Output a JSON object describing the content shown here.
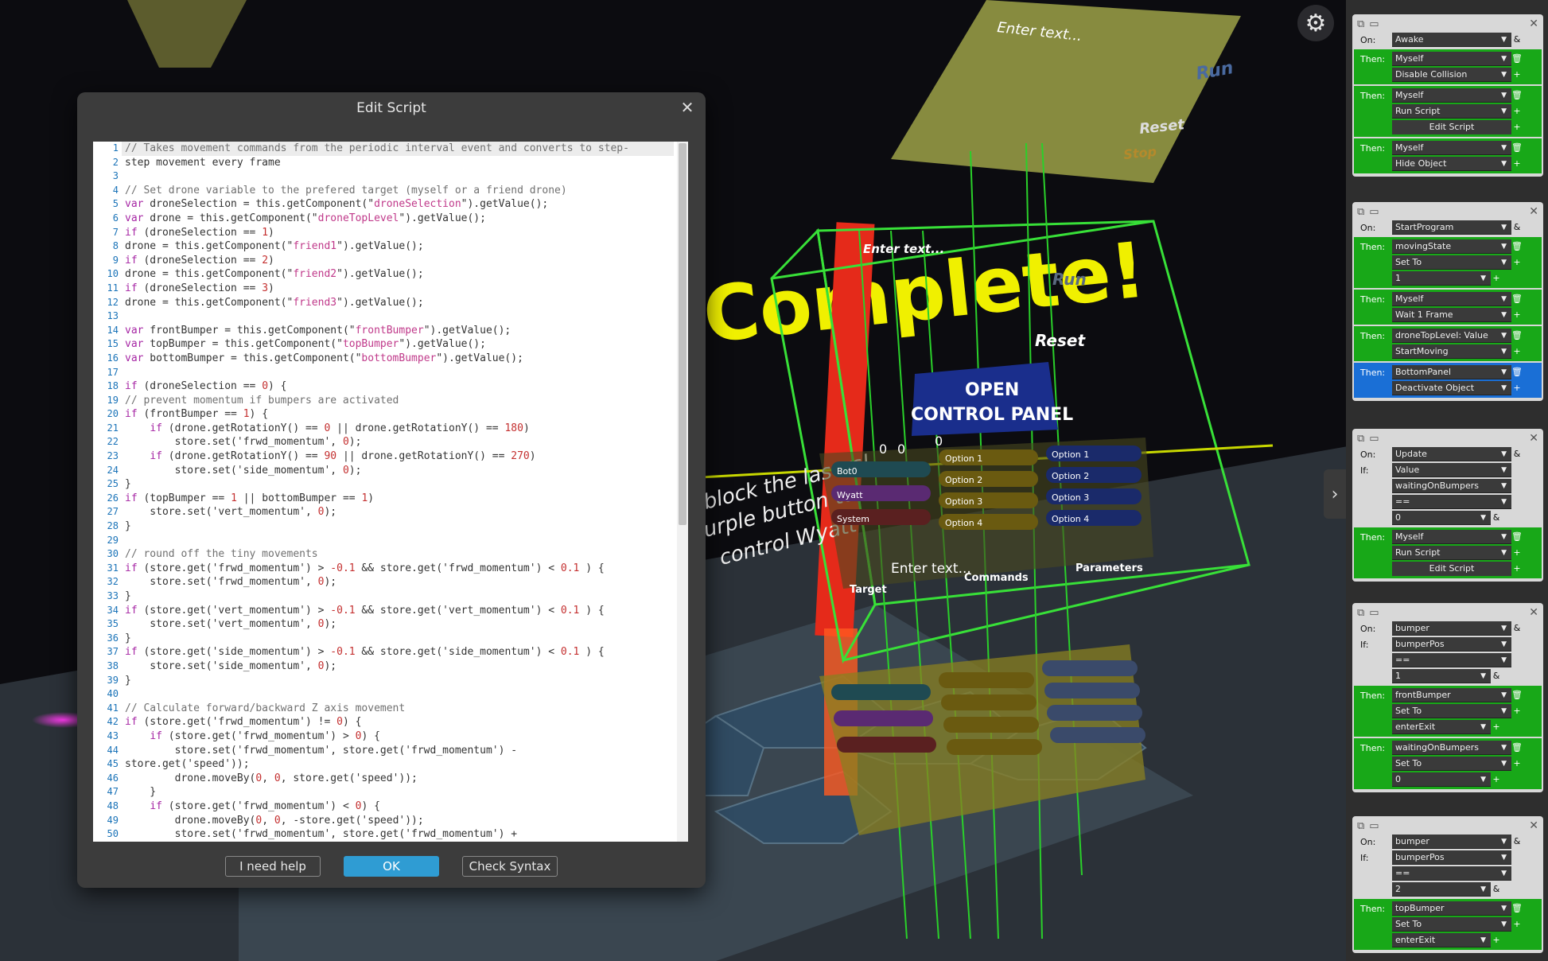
{
  "scene": {
    "board_top_text": "Enter text...",
    "board_top_run": "Run",
    "board_top_reset": "Reset",
    "board_top_stop": "Stop",
    "cube_enter_text": "Enter text...",
    "cube_run": "Run",
    "cube_reset": "Reset",
    "big_text": "Complete!",
    "open_control_panel": "OPEN\nCONTROL PANEL",
    "wall_text": "block the lasers!\nurple button to\ncontrol Wyatt",
    "ui_panel": {
      "counters": [
        "0",
        "0",
        "0"
      ],
      "bots": [
        "Bot0",
        "Wyatt",
        "System"
      ],
      "options_a": [
        "Option 1",
        "Option 2",
        "Option 3",
        "Option 4"
      ],
      "options_b": [
        "Option 1",
        "Option 2",
        "Option 3",
        "Option 4"
      ],
      "enter_text": "Enter text...",
      "target": "Target",
      "commands": "Commands",
      "parameters": "Parameters"
    },
    "toggle_icon": "chevron-right-icon"
  },
  "dialog": {
    "title": "Edit Script",
    "buttons": {
      "help": "I need help",
      "ok": "OK",
      "check": "Check Syntax"
    },
    "lines": [
      "// Takes movement commands from the periodic interval event and converts to step-",
      "step movement every frame",
      "",
      "// Set drone variable to the prefered target (myself or a friend drone)",
      "var droneSelection = this.getComponent(\"droneSelection\").getValue();",
      "var drone = this.getComponent(\"droneTopLevel\").getValue();",
      "if (droneSelection == 1)",
      "drone = this.getComponent(\"friend1\").getValue();",
      "if (droneSelection == 2)",
      "drone = this.getComponent(\"friend2\").getValue();",
      "if (droneSelection == 3)",
      "drone = this.getComponent(\"friend3\").getValue();",
      "",
      "var frontBumper = this.getComponent(\"frontBumper\").getValue();",
      "var topBumper = this.getComponent(\"topBumper\").getValue();",
      "var bottomBumper = this.getComponent(\"bottomBumper\").getValue();",
      "",
      "if (droneSelection == 0) {",
      "// prevent momentum if bumpers are activated",
      "if (frontBumper == 1) {",
      "    if (drone.getRotationY() == 0 || drone.getRotationY() == 180)",
      "        store.set('frwd_momentum', 0);",
      "    if (drone.getRotationY() == 90 || drone.getRotationY() == 270)",
      "        store.set('side_momentum', 0);",
      "}",
      "if (topBumper == 1 || bottomBumper == 1)",
      "    store.set('vert_momentum', 0);",
      "}",
      "",
      "// round off the tiny movements",
      "if (store.get('frwd_momentum') > -0.1 && store.get('frwd_momentum') < 0.1 ) {",
      "    store.set('frwd_momentum', 0);",
      "}",
      "if (store.get('vert_momentum') > -0.1 && store.get('vert_momentum') < 0.1 ) {",
      "    store.set('vert_momentum', 0);",
      "}",
      "if (store.get('side_momentum') > -0.1 && store.get('side_momentum') < 0.1 ) {",
      "    store.set('side_momentum', 0);",
      "}",
      "",
      "// Calculate forward/backward Z axis movement",
      "if (store.get('frwd_momentum') != 0) {",
      "    if (store.get('frwd_momentum') > 0) {",
      "        store.set('frwd_momentum', store.get('frwd_momentum') -",
      "store.get('speed'));",
      "        drone.moveBy(0, 0, store.get('speed'));",
      "    }",
      "    if (store.get('frwd_momentum') < 0) {",
      "        drone.moveBy(0, 0, -store.get('speed'));",
      "        store.set('frwd_momentum', store.get('frwd_momentum') +"
    ]
  },
  "panel": {
    "cards": [
      {
        "on": "Awake",
        "groups": [
          {
            "then": "Myself",
            "rows": [
              "Disable Collision"
            ]
          },
          {
            "then": "Myself",
            "rows": [
              "Run Script"
            ],
            "button": "Edit Script"
          },
          {
            "then": "Myself",
            "rows": [
              "Hide Object"
            ]
          }
        ]
      },
      {
        "on": "StartProgram",
        "groups": [
          {
            "then": "movingState",
            "rows": [
              "Set To"
            ],
            "value": "1"
          },
          {
            "then": "Myself",
            "rows": [
              "Wait 1 Frame"
            ]
          },
          {
            "then": "droneTopLevel: Value",
            "rows": [
              "StartMoving"
            ]
          },
          {
            "then": "BottomPanel",
            "rows": [
              "Deactivate Object"
            ],
            "blue": true
          }
        ]
      },
      {
        "on": "Update",
        "if": [
          "Value",
          "waitingOnBumpers",
          "==",
          "0"
        ],
        "groups": [
          {
            "then": "Myself",
            "rows": [
              "Run Script"
            ],
            "button": "Edit Script"
          }
        ]
      },
      {
        "on": "bumper",
        "if": [
          "bumperPos",
          "==",
          "1"
        ],
        "groups": [
          {
            "then": "frontBumper",
            "rows": [
              "Set To"
            ],
            "value": "enterExit"
          },
          {
            "then": "waitingOnBumpers",
            "rows": [
              "Set To"
            ],
            "value": "0"
          }
        ]
      },
      {
        "on": "bumper",
        "if": [
          "bumperPos",
          "==",
          "2"
        ],
        "groups": [
          {
            "then": "topBumper",
            "rows": [
              "Set To"
            ],
            "value": "enterExit"
          }
        ]
      }
    ],
    "labels": {
      "on": "On:",
      "if": "If:",
      "then": "Then:"
    }
  }
}
